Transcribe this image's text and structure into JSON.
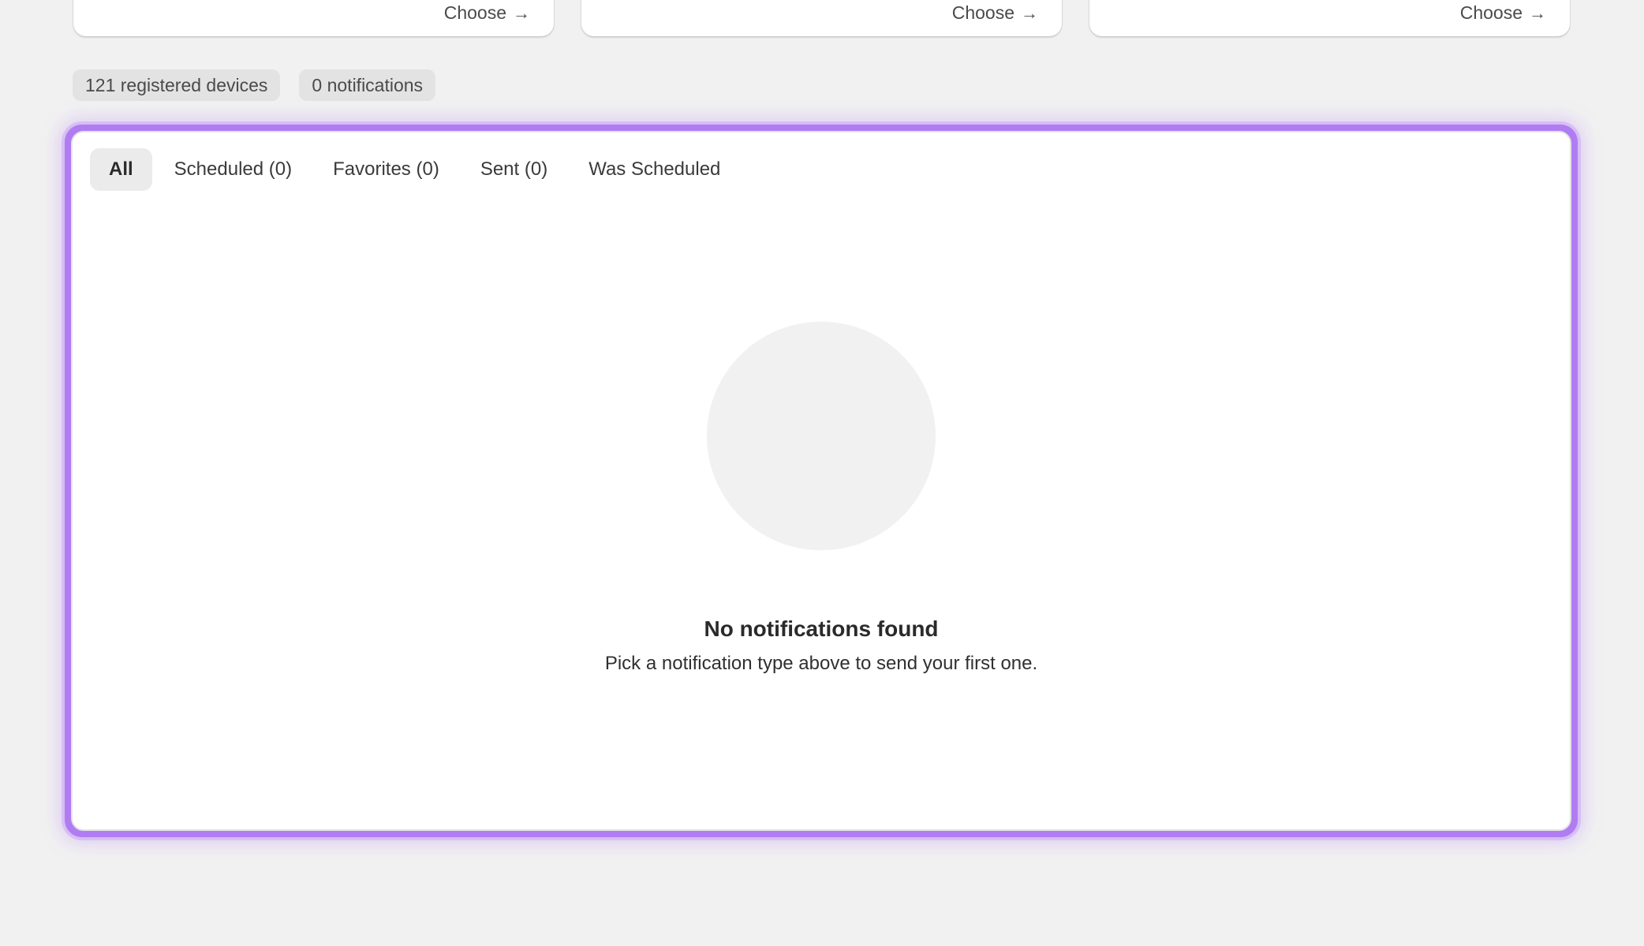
{
  "cards": [
    {
      "choose_label": "Choose",
      "arrow_icon": "arrow-right-icon"
    },
    {
      "choose_label": "Choose",
      "arrow_icon": "arrow-right-icon"
    },
    {
      "choose_label": "Choose",
      "arrow_icon": "arrow-right-icon"
    }
  ],
  "badges": {
    "devices": "121 registered devices",
    "notifications": "0 notifications"
  },
  "tabs": [
    {
      "label": "All",
      "active": true
    },
    {
      "label": "Scheduled (0)",
      "active": false
    },
    {
      "label": "Favorites (0)",
      "active": false
    },
    {
      "label": "Sent (0)",
      "active": false
    },
    {
      "label": "Was Scheduled",
      "active": false
    }
  ],
  "empty_state": {
    "title": "No notifications found",
    "subtitle": "Pick a notification type above to send your first one."
  },
  "colors": {
    "accent": "#b07cf2",
    "background": "#f1f1f1"
  }
}
